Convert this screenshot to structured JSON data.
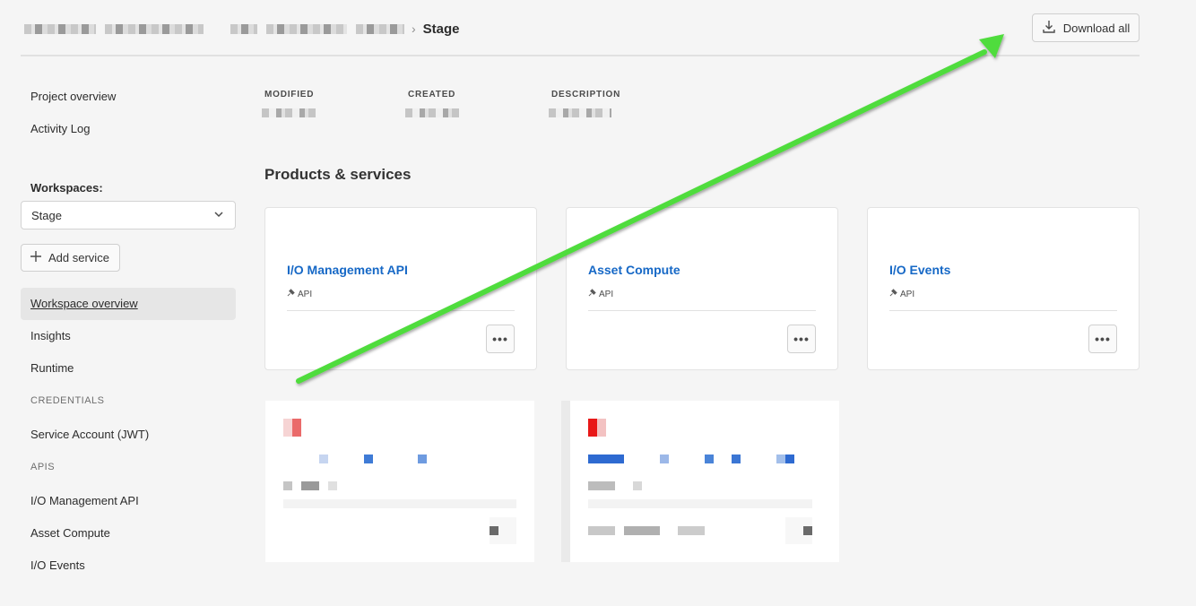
{
  "header": {
    "breadcrumb_current": "Stage",
    "download_label": "Download all",
    "download_icon": "download-icon"
  },
  "sidebar": {
    "top_items": [
      {
        "label": "Project overview"
      },
      {
        "label": "Activity Log"
      }
    ],
    "workspaces_label": "Workspaces:",
    "workspace_selected": "Stage",
    "add_service_label": "Add service",
    "workspace_items": [
      {
        "label": "Workspace overview",
        "active": true
      },
      {
        "label": "Insights"
      },
      {
        "label": "Runtime"
      }
    ],
    "credentials_label": "CREDENTIALS",
    "credentials_items": [
      {
        "label": "Service Account (JWT)"
      }
    ],
    "apis_label": "APIS",
    "api_items": [
      {
        "label": "I/O Management API"
      },
      {
        "label": "Asset Compute"
      },
      {
        "label": "I/O Events"
      }
    ]
  },
  "meta": {
    "modified_label": "MODIFIED",
    "created_label": "CREATED",
    "description_label": "DESCRIPTION"
  },
  "products": {
    "title": "Products & services",
    "cards": [
      {
        "title": "I/O Management API",
        "type": "API"
      },
      {
        "title": "Asset Compute",
        "type": "API"
      },
      {
        "title": "I/O Events",
        "type": "API"
      }
    ],
    "more_label": "•••"
  },
  "annotation": {
    "arrow_color": "#4fdc3c"
  }
}
